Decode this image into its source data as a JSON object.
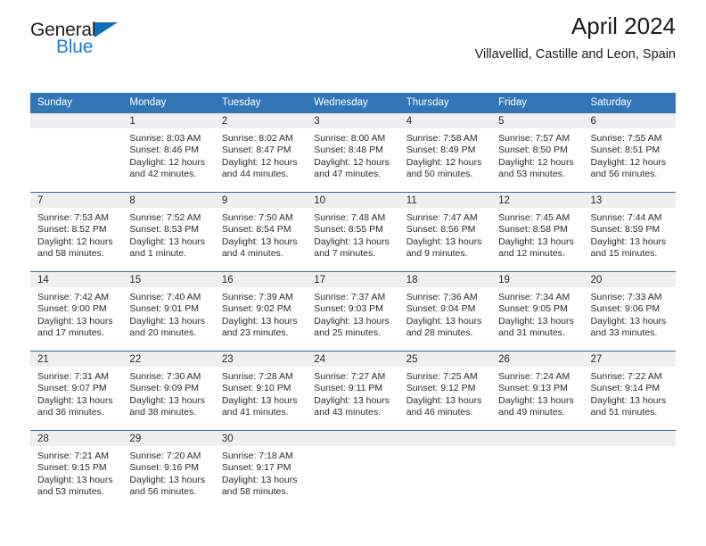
{
  "brand": {
    "name_part1": "General",
    "name_part2": "Blue"
  },
  "header": {
    "title": "April 2024",
    "subtitle": "Villavellid, Castille and Leon, Spain"
  },
  "colors": {
    "header_blue": "#3276b8",
    "row_divider_blue": "#2e6da4",
    "day_band_gray": "#efefef",
    "brand_blue": "#1b7fd4",
    "logo_triangle_blue": "#0d70bd"
  },
  "day_names": [
    "Sunday",
    "Monday",
    "Tuesday",
    "Wednesday",
    "Thursday",
    "Friday",
    "Saturday"
  ],
  "weeks": [
    [
      {
        "date": "",
        "empty": true
      },
      {
        "date": "1",
        "sunrise": "Sunrise: 8:03 AM",
        "sunset": "Sunset: 8:46 PM",
        "daylight_line1": "Daylight: 12 hours",
        "daylight_line2": "and 42 minutes."
      },
      {
        "date": "2",
        "sunrise": "Sunrise: 8:02 AM",
        "sunset": "Sunset: 8:47 PM",
        "daylight_line1": "Daylight: 12 hours",
        "daylight_line2": "and 44 minutes."
      },
      {
        "date": "3",
        "sunrise": "Sunrise: 8:00 AM",
        "sunset": "Sunset: 8:48 PM",
        "daylight_line1": "Daylight: 12 hours",
        "daylight_line2": "and 47 minutes."
      },
      {
        "date": "4",
        "sunrise": "Sunrise: 7:58 AM",
        "sunset": "Sunset: 8:49 PM",
        "daylight_line1": "Daylight: 12 hours",
        "daylight_line2": "and 50 minutes."
      },
      {
        "date": "5",
        "sunrise": "Sunrise: 7:57 AM",
        "sunset": "Sunset: 8:50 PM",
        "daylight_line1": "Daylight: 12 hours",
        "daylight_line2": "and 53 minutes."
      },
      {
        "date": "6",
        "sunrise": "Sunrise: 7:55 AM",
        "sunset": "Sunset: 8:51 PM",
        "daylight_line1": "Daylight: 12 hours",
        "daylight_line2": "and 56 minutes."
      }
    ],
    [
      {
        "date": "7",
        "sunrise": "Sunrise: 7:53 AM",
        "sunset": "Sunset: 8:52 PM",
        "daylight_line1": "Daylight: 12 hours",
        "daylight_line2": "and 58 minutes."
      },
      {
        "date": "8",
        "sunrise": "Sunrise: 7:52 AM",
        "sunset": "Sunset: 8:53 PM",
        "daylight_line1": "Daylight: 13 hours",
        "daylight_line2": "and 1 minute."
      },
      {
        "date": "9",
        "sunrise": "Sunrise: 7:50 AM",
        "sunset": "Sunset: 8:54 PM",
        "daylight_line1": "Daylight: 13 hours",
        "daylight_line2": "and 4 minutes."
      },
      {
        "date": "10",
        "sunrise": "Sunrise: 7:48 AM",
        "sunset": "Sunset: 8:55 PM",
        "daylight_line1": "Daylight: 13 hours",
        "daylight_line2": "and 7 minutes."
      },
      {
        "date": "11",
        "sunrise": "Sunrise: 7:47 AM",
        "sunset": "Sunset: 8:56 PM",
        "daylight_line1": "Daylight: 13 hours",
        "daylight_line2": "and 9 minutes."
      },
      {
        "date": "12",
        "sunrise": "Sunrise: 7:45 AM",
        "sunset": "Sunset: 8:58 PM",
        "daylight_line1": "Daylight: 13 hours",
        "daylight_line2": "and 12 minutes."
      },
      {
        "date": "13",
        "sunrise": "Sunrise: 7:44 AM",
        "sunset": "Sunset: 8:59 PM",
        "daylight_line1": "Daylight: 13 hours",
        "daylight_line2": "and 15 minutes."
      }
    ],
    [
      {
        "date": "14",
        "sunrise": "Sunrise: 7:42 AM",
        "sunset": "Sunset: 9:00 PM",
        "daylight_line1": "Daylight: 13 hours",
        "daylight_line2": "and 17 minutes."
      },
      {
        "date": "15",
        "sunrise": "Sunrise: 7:40 AM",
        "sunset": "Sunset: 9:01 PM",
        "daylight_line1": "Daylight: 13 hours",
        "daylight_line2": "and 20 minutes."
      },
      {
        "date": "16",
        "sunrise": "Sunrise: 7:39 AM",
        "sunset": "Sunset: 9:02 PM",
        "daylight_line1": "Daylight: 13 hours",
        "daylight_line2": "and 23 minutes."
      },
      {
        "date": "17",
        "sunrise": "Sunrise: 7:37 AM",
        "sunset": "Sunset: 9:03 PM",
        "daylight_line1": "Daylight: 13 hours",
        "daylight_line2": "and 25 minutes."
      },
      {
        "date": "18",
        "sunrise": "Sunrise: 7:36 AM",
        "sunset": "Sunset: 9:04 PM",
        "daylight_line1": "Daylight: 13 hours",
        "daylight_line2": "and 28 minutes."
      },
      {
        "date": "19",
        "sunrise": "Sunrise: 7:34 AM",
        "sunset": "Sunset: 9:05 PM",
        "daylight_line1": "Daylight: 13 hours",
        "daylight_line2": "and 31 minutes."
      },
      {
        "date": "20",
        "sunrise": "Sunrise: 7:33 AM",
        "sunset": "Sunset: 9:06 PM",
        "daylight_line1": "Daylight: 13 hours",
        "daylight_line2": "and 33 minutes."
      }
    ],
    [
      {
        "date": "21",
        "sunrise": "Sunrise: 7:31 AM",
        "sunset": "Sunset: 9:07 PM",
        "daylight_line1": "Daylight: 13 hours",
        "daylight_line2": "and 36 minutes."
      },
      {
        "date": "22",
        "sunrise": "Sunrise: 7:30 AM",
        "sunset": "Sunset: 9:09 PM",
        "daylight_line1": "Daylight: 13 hours",
        "daylight_line2": "and 38 minutes."
      },
      {
        "date": "23",
        "sunrise": "Sunrise: 7:28 AM",
        "sunset": "Sunset: 9:10 PM",
        "daylight_line1": "Daylight: 13 hours",
        "daylight_line2": "and 41 minutes."
      },
      {
        "date": "24",
        "sunrise": "Sunrise: 7:27 AM",
        "sunset": "Sunset: 9:11 PM",
        "daylight_line1": "Daylight: 13 hours",
        "daylight_line2": "and 43 minutes."
      },
      {
        "date": "25",
        "sunrise": "Sunrise: 7:25 AM",
        "sunset": "Sunset: 9:12 PM",
        "daylight_line1": "Daylight: 13 hours",
        "daylight_line2": "and 46 minutes."
      },
      {
        "date": "26",
        "sunrise": "Sunrise: 7:24 AM",
        "sunset": "Sunset: 9:13 PM",
        "daylight_line1": "Daylight: 13 hours",
        "daylight_line2": "and 49 minutes."
      },
      {
        "date": "27",
        "sunrise": "Sunrise: 7:22 AM",
        "sunset": "Sunset: 9:14 PM",
        "daylight_line1": "Daylight: 13 hours",
        "daylight_line2": "and 51 minutes."
      }
    ],
    [
      {
        "date": "28",
        "sunrise": "Sunrise: 7:21 AM",
        "sunset": "Sunset: 9:15 PM",
        "daylight_line1": "Daylight: 13 hours",
        "daylight_line2": "and 53 minutes."
      },
      {
        "date": "29",
        "sunrise": "Sunrise: 7:20 AM",
        "sunset": "Sunset: 9:16 PM",
        "daylight_line1": "Daylight: 13 hours",
        "daylight_line2": "and 56 minutes."
      },
      {
        "date": "30",
        "sunrise": "Sunrise: 7:18 AM",
        "sunset": "Sunset: 9:17 PM",
        "daylight_line1": "Daylight: 13 hours",
        "daylight_line2": "and 58 minutes."
      },
      {
        "date": "",
        "empty": true
      },
      {
        "date": "",
        "empty": true
      },
      {
        "date": "",
        "empty": true
      },
      {
        "date": "",
        "empty": true
      }
    ]
  ]
}
